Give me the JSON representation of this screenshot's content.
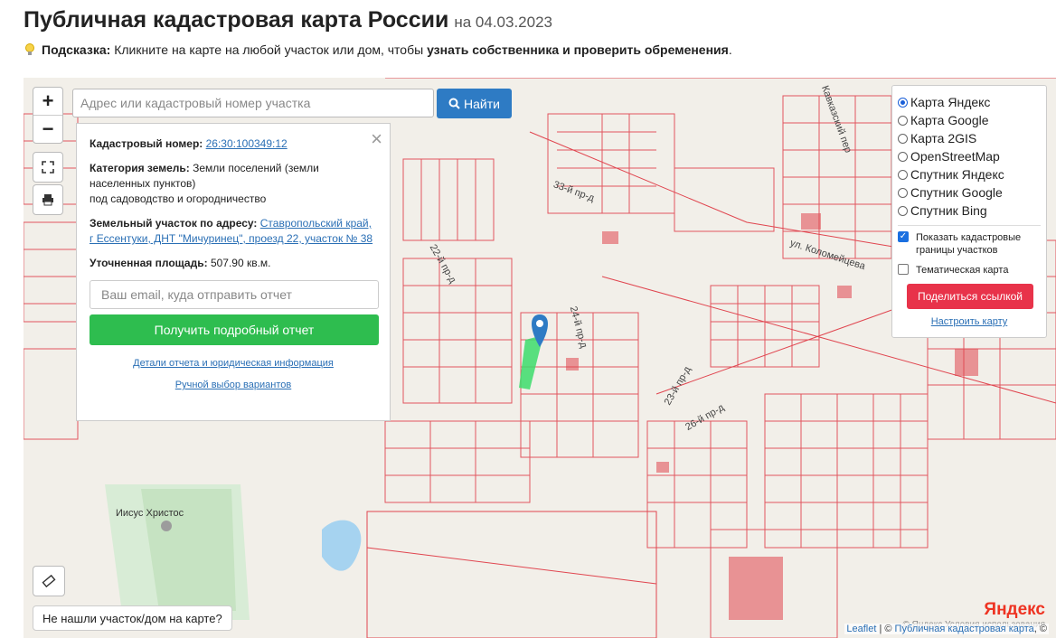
{
  "header": {
    "title": "Публичная кадастровая карта России",
    "date": "на 04.03.2023",
    "hint_label": "Подсказка:",
    "hint_text": "Кликните на карте на любой участок или дом, чтобы",
    "hint_bold": "узнать собственника и проверить обременения",
    "hint_end": "."
  },
  "map_controls": {
    "zoom_in": "+",
    "zoom_out": "−",
    "search_placeholder": "Адрес или кадастровый номер участка",
    "find_label": "Найти"
  },
  "parcel_panel": {
    "cadastral_label": "Кадастровый номер:",
    "cadastral_value": "26:30:100349:12",
    "category_label": "Категория земель:",
    "category_value": "Земли поселений (земли населенных пунктов)",
    "category_use": "под садоводство и огородничество",
    "address_label": "Земельный участок по адресу:",
    "address_value": "Ставропольский край, г Ессентуки, ДНТ \"Мичуринец\", проезд 22, участок № 38",
    "area_label": "Уточненная площадь:",
    "area_value": "507.90 кв.м.",
    "email_placeholder": "Ваш email, куда отправить отчет",
    "report_button": "Получить подробный отчет",
    "details_link": "Детали отчета и юридическая информация",
    "manual_link": "Ручной выбор вариантов"
  },
  "layers": {
    "options": [
      "Карта Яндекс",
      "Карта Google",
      "Карта 2GIS",
      "OpenStreetMap",
      "Спутник Яндекс",
      "Спутник Google",
      "Спутник Bing"
    ],
    "selected": "Карта Яндекс",
    "show_borders": "Показать кадастровые границы участков",
    "show_borders_checked": true,
    "thematic": "Тематическая карта",
    "thematic_checked": false,
    "share_button": "Поделиться ссылкой",
    "configure_link": "Настроить карту"
  },
  "footer": {
    "not_found": "Не нашли участок/дом на карте?",
    "attribution_leaflet": "Leaflet",
    "attribution_sep": " | © ",
    "attribution_pkk": "Публичная кадастровая карта",
    "attribution_end": ", ©",
    "yandex_logo": "Яндекс",
    "yandex_terms": "© Яндекс  Условия использования"
  },
  "map_labels": {
    "church": "Иисус Христос",
    "street1": "ул. Коломейцева",
    "street2": "Кавказский пер",
    "street3": "22-й пр-д",
    "street4": "23-й пр-д",
    "street5": "24-й пр-д",
    "street6": "26-й пр-д",
    "street7": "33-й пр-д"
  },
  "colors": {
    "parcel_line": "#e0454f",
    "search_button": "#2e7bc4",
    "report_button": "#2ebd4f",
    "share_button": "#e8334a",
    "highlight": "#3ddc6b"
  }
}
